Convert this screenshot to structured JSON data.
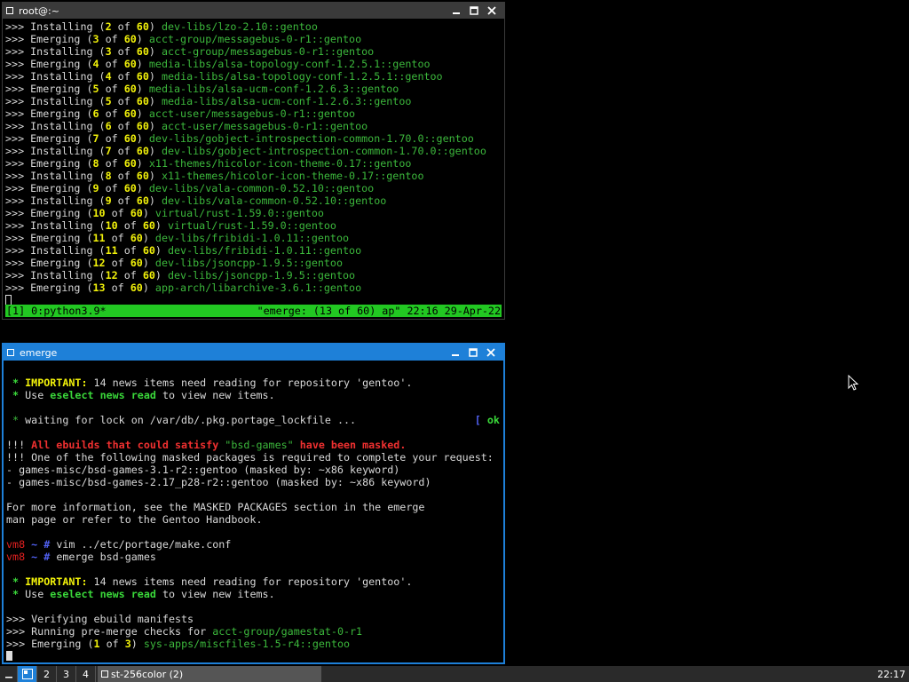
{
  "window1": {
    "title": "root@:~",
    "lines": [
      [
        {
          "t": ">>> Installing ("
        },
        {
          "t": "2",
          "c": "y"
        },
        {
          "t": " of "
        },
        {
          "t": "60",
          "c": "y"
        },
        {
          "t": ") "
        },
        {
          "t": "dev-libs/lzo-2.10::gentoo",
          "c": "g"
        }
      ],
      [
        {
          "t": ">>> Emerging ("
        },
        {
          "t": "3",
          "c": "y"
        },
        {
          "t": " of "
        },
        {
          "t": "60",
          "c": "y"
        },
        {
          "t": ") "
        },
        {
          "t": "acct-group/messagebus-0-r1::gentoo",
          "c": "g"
        }
      ],
      [
        {
          "t": ">>> Installing ("
        },
        {
          "t": "3",
          "c": "y"
        },
        {
          "t": " of "
        },
        {
          "t": "60",
          "c": "y"
        },
        {
          "t": ") "
        },
        {
          "t": "acct-group/messagebus-0-r1::gentoo",
          "c": "g"
        }
      ],
      [
        {
          "t": ">>> Emerging ("
        },
        {
          "t": "4",
          "c": "y"
        },
        {
          "t": " of "
        },
        {
          "t": "60",
          "c": "y"
        },
        {
          "t": ") "
        },
        {
          "t": "media-libs/alsa-topology-conf-1.2.5.1::gentoo",
          "c": "g"
        }
      ],
      [
        {
          "t": ">>> Installing ("
        },
        {
          "t": "4",
          "c": "y"
        },
        {
          "t": " of "
        },
        {
          "t": "60",
          "c": "y"
        },
        {
          "t": ") "
        },
        {
          "t": "media-libs/alsa-topology-conf-1.2.5.1::gentoo",
          "c": "g"
        }
      ],
      [
        {
          "t": ">>> Emerging ("
        },
        {
          "t": "5",
          "c": "y"
        },
        {
          "t": " of "
        },
        {
          "t": "60",
          "c": "y"
        },
        {
          "t": ") "
        },
        {
          "t": "media-libs/alsa-ucm-conf-1.2.6.3::gentoo",
          "c": "g"
        }
      ],
      [
        {
          "t": ">>> Installing ("
        },
        {
          "t": "5",
          "c": "y"
        },
        {
          "t": " of "
        },
        {
          "t": "60",
          "c": "y"
        },
        {
          "t": ") "
        },
        {
          "t": "media-libs/alsa-ucm-conf-1.2.6.3::gentoo",
          "c": "g"
        }
      ],
      [
        {
          "t": ">>> Emerging ("
        },
        {
          "t": "6",
          "c": "y"
        },
        {
          "t": " of "
        },
        {
          "t": "60",
          "c": "y"
        },
        {
          "t": ") "
        },
        {
          "t": "acct-user/messagebus-0-r1::gentoo",
          "c": "g"
        }
      ],
      [
        {
          "t": ">>> Installing ("
        },
        {
          "t": "6",
          "c": "y"
        },
        {
          "t": " of "
        },
        {
          "t": "60",
          "c": "y"
        },
        {
          "t": ") "
        },
        {
          "t": "acct-user/messagebus-0-r1::gentoo",
          "c": "g"
        }
      ],
      [
        {
          "t": ">>> Emerging ("
        },
        {
          "t": "7",
          "c": "y"
        },
        {
          "t": " of "
        },
        {
          "t": "60",
          "c": "y"
        },
        {
          "t": ") "
        },
        {
          "t": "dev-libs/gobject-introspection-common-1.70.0::gentoo",
          "c": "g"
        }
      ],
      [
        {
          "t": ">>> Installing ("
        },
        {
          "t": "7",
          "c": "y"
        },
        {
          "t": " of "
        },
        {
          "t": "60",
          "c": "y"
        },
        {
          "t": ") "
        },
        {
          "t": "dev-libs/gobject-introspection-common-1.70.0::gentoo",
          "c": "g"
        }
      ],
      [
        {
          "t": ">>> Emerging ("
        },
        {
          "t": "8",
          "c": "y"
        },
        {
          "t": " of "
        },
        {
          "t": "60",
          "c": "y"
        },
        {
          "t": ") "
        },
        {
          "t": "x11-themes/hicolor-icon-theme-0.17::gentoo",
          "c": "g"
        }
      ],
      [
        {
          "t": ">>> Installing ("
        },
        {
          "t": "8",
          "c": "y"
        },
        {
          "t": " of "
        },
        {
          "t": "60",
          "c": "y"
        },
        {
          "t": ") "
        },
        {
          "t": "x11-themes/hicolor-icon-theme-0.17::gentoo",
          "c": "g"
        }
      ],
      [
        {
          "t": ">>> Emerging ("
        },
        {
          "t": "9",
          "c": "y"
        },
        {
          "t": " of "
        },
        {
          "t": "60",
          "c": "y"
        },
        {
          "t": ") "
        },
        {
          "t": "dev-libs/vala-common-0.52.10::gentoo",
          "c": "g"
        }
      ],
      [
        {
          "t": ">>> Installing ("
        },
        {
          "t": "9",
          "c": "y"
        },
        {
          "t": " of "
        },
        {
          "t": "60",
          "c": "y"
        },
        {
          "t": ") "
        },
        {
          "t": "dev-libs/vala-common-0.52.10::gentoo",
          "c": "g"
        }
      ],
      [
        {
          "t": ">>> Emerging ("
        },
        {
          "t": "10",
          "c": "y"
        },
        {
          "t": " of "
        },
        {
          "t": "60",
          "c": "y"
        },
        {
          "t": ") "
        },
        {
          "t": "virtual/rust-1.59.0::gentoo",
          "c": "g"
        }
      ],
      [
        {
          "t": ">>> Installing ("
        },
        {
          "t": "10",
          "c": "y"
        },
        {
          "t": " of "
        },
        {
          "t": "60",
          "c": "y"
        },
        {
          "t": ") "
        },
        {
          "t": "virtual/rust-1.59.0::gentoo",
          "c": "g"
        }
      ],
      [
        {
          "t": ">>> Emerging ("
        },
        {
          "t": "11",
          "c": "y"
        },
        {
          "t": " of "
        },
        {
          "t": "60",
          "c": "y"
        },
        {
          "t": ") "
        },
        {
          "t": "dev-libs/fribidi-1.0.11::gentoo",
          "c": "g"
        }
      ],
      [
        {
          "t": ">>> Installing ("
        },
        {
          "t": "11",
          "c": "y"
        },
        {
          "t": " of "
        },
        {
          "t": "60",
          "c": "y"
        },
        {
          "t": ") "
        },
        {
          "t": "dev-libs/fribidi-1.0.11::gentoo",
          "c": "g"
        }
      ],
      [
        {
          "t": ">>> Emerging ("
        },
        {
          "t": "12",
          "c": "y"
        },
        {
          "t": " of "
        },
        {
          "t": "60",
          "c": "y"
        },
        {
          "t": ") "
        },
        {
          "t": "dev-libs/jsoncpp-1.9.5::gentoo",
          "c": "g"
        }
      ],
      [
        {
          "t": ">>> Installing ("
        },
        {
          "t": "12",
          "c": "y"
        },
        {
          "t": " of "
        },
        {
          "t": "60",
          "c": "y"
        },
        {
          "t": ") "
        },
        {
          "t": "dev-libs/jsoncpp-1.9.5::gentoo",
          "c": "g"
        }
      ],
      [
        {
          "t": ">>> Emerging ("
        },
        {
          "t": "13",
          "c": "y"
        },
        {
          "t": " of "
        },
        {
          "t": "60",
          "c": "y"
        },
        {
          "t": ") "
        },
        {
          "t": "app-arch/libarchive-3.6.1::gentoo",
          "c": "g"
        }
      ]
    ],
    "status_left": "[1] 0:python3.9*",
    "status_right": "\"emerge: (13 of 60) ap\" 22:16 29-Apr-22"
  },
  "window2": {
    "title": "emerge",
    "lines": [
      [],
      [
        {
          "t": " * ",
          "c": "gb"
        },
        {
          "t": "IMPORTANT:",
          "c": "y"
        },
        {
          "t": " 14 news items need reading for repository 'gentoo'."
        }
      ],
      [
        {
          "t": " * ",
          "c": "gb"
        },
        {
          "t": "Use "
        },
        {
          "t": "eselect news read",
          "c": "gb"
        },
        {
          "t": " to view new items."
        }
      ],
      [],
      [
        {
          "t": " * ",
          "c": "g"
        },
        {
          "t": "waiting for lock on /var/db/.pkg.portage_lockfile ...                   "
        },
        {
          "t": "[ ",
          "c": "b"
        },
        {
          "t": "ok",
          "c": "gb"
        },
        {
          "t": " ]",
          "c": "b"
        }
      ],
      [],
      [
        {
          "t": "!!! "
        },
        {
          "t": "All ebuilds that could satisfy ",
          "c": "rb"
        },
        {
          "t": "\"bsd-games\"",
          "c": "g"
        },
        {
          "t": " have been masked.",
          "c": "rb"
        }
      ],
      [
        {
          "t": "!!! One of the following masked packages is required to complete your request:"
        }
      ],
      [
        {
          "t": "- games-misc/bsd-games-3.1-r2::gentoo (masked by: ~x86 keyword)"
        }
      ],
      [
        {
          "t": "- games-misc/bsd-games-2.17_p28-r2::gentoo (masked by: ~x86 keyword)"
        }
      ],
      [],
      [
        {
          "t": "For more information, see the MASKED PACKAGES section in the emerge"
        }
      ],
      [
        {
          "t": "man page or refer to the Gentoo Handbook."
        }
      ],
      [],
      [
        {
          "t": "vm8",
          "c": "r"
        },
        {
          "t": " ~ # ",
          "c": "b"
        },
        {
          "t": "vim ../etc/portage/make.conf"
        }
      ],
      [
        {
          "t": "vm8",
          "c": "r"
        },
        {
          "t": " ~ # ",
          "c": "b"
        },
        {
          "t": "emerge bsd-games"
        }
      ],
      [],
      [
        {
          "t": " * ",
          "c": "gb"
        },
        {
          "t": "IMPORTANT:",
          "c": "y"
        },
        {
          "t": " 14 news items need reading for repository 'gentoo'."
        }
      ],
      [
        {
          "t": " * ",
          "c": "gb"
        },
        {
          "t": "Use "
        },
        {
          "t": "eselect news read",
          "c": "gb"
        },
        {
          "t": " to view new items."
        }
      ],
      [],
      [
        {
          "t": ">>> Verifying ebuild manifests"
        }
      ],
      [
        {
          "t": ">>> Running pre-merge checks for "
        },
        {
          "t": "acct-group/gamestat-0-r1",
          "c": "g"
        }
      ],
      [
        {
          "t": ">>> Emerging ("
        },
        {
          "t": "1",
          "c": "y"
        },
        {
          "t": " of "
        },
        {
          "t": "3",
          "c": "y"
        },
        {
          "t": ") "
        },
        {
          "t": "sys-apps/miscfiles-1.5-r4::gentoo",
          "c": "g"
        }
      ]
    ]
  },
  "taskbar": {
    "workspaces": [
      "2",
      "3",
      "4"
    ],
    "task_label": "st-256color (2)",
    "clock": "22:17"
  }
}
